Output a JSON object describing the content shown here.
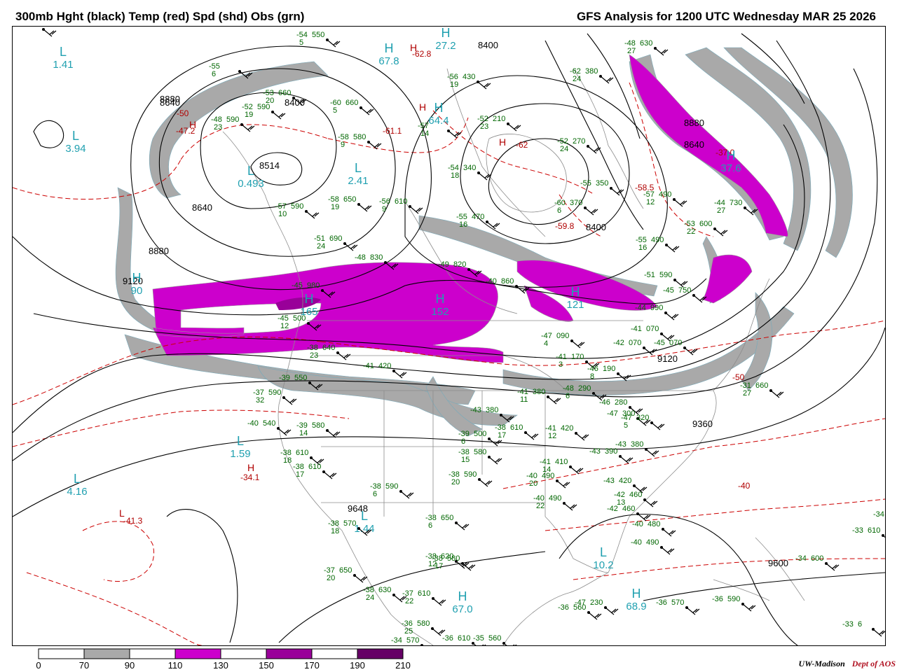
{
  "header": {
    "left_title": "300mb Hght (black) Temp (red) Spd (shd) Obs (grn)",
    "right_title": "GFS Analysis for 1200 UTC Wednesday  MAR 25 2026"
  },
  "colors": {
    "height_contour": "#000000",
    "temp_contour": "#cc0000",
    "speed_70_90": "#a9a9a9",
    "speed_110_130": "#cc00cc",
    "speed_150_170": "#990099",
    "speed_190_210": "#660066",
    "obs": "#006600",
    "pressure_centers": "#20a0b0",
    "borders": "#808080"
  },
  "legend": {
    "labels": [
      "0",
      "70",
      "90",
      "110",
      "130",
      "150",
      "170",
      "190",
      "210"
    ],
    "fills": [
      "#ffffff",
      "#a9a9a9",
      "#ffffff",
      "#cc00cc",
      "#ffffff",
      "#990099",
      "#ffffff",
      "#660066"
    ]
  },
  "credit": {
    "org": "UW-Madison",
    "dept": "Dept of AOS"
  },
  "height_labels": [
    {
      "text": "8880"
    },
    {
      "text": "8640"
    },
    {
      "text": "8514"
    },
    {
      "text": "8640"
    },
    {
      "text": "8880"
    },
    {
      "text": "9120"
    },
    {
      "text": "8400"
    },
    {
      "text": "8400"
    },
    {
      "text": "8640"
    },
    {
      "text": "8880"
    },
    {
      "text": "9120"
    },
    {
      "text": "9360"
    },
    {
      "text": "9648"
    },
    {
      "text": "9600"
    },
    {
      "text": "8400"
    }
  ],
  "temp_labels": [
    {
      "text": "-47.2"
    },
    {
      "text": "-50"
    },
    {
      "text": "-61.1"
    },
    {
      "text": "-62.8"
    },
    {
      "text": "-58.5"
    },
    {
      "text": "-59.8"
    },
    {
      "text": "-37.0"
    },
    {
      "text": "-50"
    },
    {
      "text": "-40"
    },
    {
      "text": "-34.1"
    },
    {
      "text": "-41.3"
    },
    {
      "text": "-62"
    }
  ],
  "centers": [
    {
      "letter": "L",
      "value": "1.41"
    },
    {
      "letter": "L",
      "value": "3.94"
    },
    {
      "letter": "L",
      "value": "0.493"
    },
    {
      "letter": "L",
      "value": "2.41"
    },
    {
      "letter": "H",
      "value": "67.8"
    },
    {
      "letter": "H",
      "value": "64.4"
    },
    {
      "letter": "L",
      "value": "1.59"
    },
    {
      "letter": "L",
      "value": "4.16"
    },
    {
      "letter": "L",
      "value": "1.44"
    },
    {
      "letter": "L",
      "value": "10.2"
    },
    {
      "letter": "H",
      "value": "67.0"
    },
    {
      "letter": "H",
      "value": "68.9"
    },
    {
      "letter": "H",
      "value": "27.2"
    },
    {
      "letter": "H",
      "value": "37.6"
    },
    {
      "letter": "H",
      "value": "90"
    },
    {
      "letter": "H",
      "value": "165"
    },
    {
      "letter": "H",
      "value": "152"
    },
    {
      "letter": "H",
      "value": "121"
    }
  ],
  "extrema_labels": [
    {
      "text": "H"
    },
    {
      "text": "H"
    },
    {
      "text": "H"
    },
    {
      "text": "H"
    },
    {
      "text": "L"
    },
    {
      "text": "H"
    }
  ],
  "obs": [
    {
      "t": "-54",
      "h": "550",
      "s": "5"
    },
    {
      "t": "-53",
      "h": "660",
      "s": "20"
    },
    {
      "t": "-55",
      "h": "",
      "s": "6"
    },
    {
      "t": "-52",
      "h": "590",
      "s": "19"
    },
    {
      "t": "-48",
      "h": "590",
      "s": "23"
    },
    {
      "t": "-60",
      "h": "660",
      "s": "5"
    },
    {
      "t": "-58",
      "h": "580",
      "s": "9"
    },
    {
      "t": "-57",
      "h": "",
      "s": "14"
    },
    {
      "t": "-56",
      "h": "430",
      "s": "19"
    },
    {
      "t": "-52",
      "h": "210",
      "s": "23"
    },
    {
      "t": "-52",
      "h": "270",
      "s": "24"
    },
    {
      "t": "-62",
      "h": "380",
      "s": "24"
    },
    {
      "t": "-48",
      "h": "630",
      "s": "27"
    },
    {
      "t": "-54",
      "h": "340",
      "s": "18"
    },
    {
      "t": "-55",
      "h": "350",
      "s": ""
    },
    {
      "t": "-57",
      "h": "490",
      "s": "12"
    },
    {
      "t": "-60",
      "h": "370",
      "s": "6"
    },
    {
      "t": "-58",
      "h": "650",
      "s": "19"
    },
    {
      "t": "-56",
      "h": "610",
      "s": "9"
    },
    {
      "t": "-57",
      "h": "590",
      "s": "10"
    },
    {
      "t": "-51",
      "h": "690",
      "s": "24"
    },
    {
      "t": "-55",
      "h": "470",
      "s": "16"
    },
    {
      "t": "-44",
      "h": "730",
      "s": "27"
    },
    {
      "t": "-53",
      "h": "600",
      "s": "22"
    },
    {
      "t": "-55",
      "h": "490",
      "s": "16"
    },
    {
      "t": "-51",
      "h": "590",
      "s": ""
    },
    {
      "t": "-45",
      "h": "750",
      "s": ""
    },
    {
      "t": "-48",
      "h": "830",
      "s": ""
    },
    {
      "t": "-49",
      "h": "820",
      "s": ""
    },
    {
      "t": "-40",
      "h": "860",
      "s": ""
    },
    {
      "t": "-45",
      "h": "980",
      "s": ""
    },
    {
      "t": "-44",
      "h": "990",
      "s": ""
    },
    {
      "t": "-41",
      "h": "070",
      "s": ""
    },
    {
      "t": "-42",
      "h": "070",
      "s": ""
    },
    {
      "t": "-45",
      "h": "070",
      "s": ""
    },
    {
      "t": "-47",
      "h": "090",
      "s": "4"
    },
    {
      "t": "-41",
      "h": "170",
      "s": "3"
    },
    {
      "t": "-46",
      "h": "190",
      "s": "8"
    },
    {
      "t": "-48",
      "h": "290",
      "s": "6"
    },
    {
      "t": "-41",
      "h": "380",
      "s": "11"
    },
    {
      "t": "-46",
      "h": "280",
      "s": ""
    },
    {
      "t": "-47",
      "h": "300",
      "s": ""
    },
    {
      "t": "-47",
      "h": "320",
      "s": "5"
    },
    {
      "t": "-43",
      "h": "380",
      "s": ""
    },
    {
      "t": "-41",
      "h": "420",
      "s": "12"
    },
    {
      "t": "-43",
      "h": "390",
      "s": ""
    },
    {
      "t": "-41",
      "h": "410",
      "s": "14"
    },
    {
      "t": "-43",
      "h": "420",
      "s": ""
    },
    {
      "t": "-40",
      "h": "490",
      "s": "20"
    },
    {
      "t": "-40",
      "h": "490",
      "s": "22"
    },
    {
      "t": "-42",
      "h": "460",
      "s": "13"
    },
    {
      "t": "-42",
      "h": "460",
      "s": ""
    },
    {
      "t": "-40",
      "h": "480",
      "s": ""
    },
    {
      "t": "-40",
      "h": "490",
      "s": ""
    },
    {
      "t": "-43",
      "h": "380",
      "s": ""
    },
    {
      "t": "-38",
      "h": "610",
      "s": "17"
    },
    {
      "t": "-39",
      "h": "500",
      "s": "6"
    },
    {
      "t": "-38",
      "h": "580",
      "s": "15"
    },
    {
      "t": "-38",
      "h": "590",
      "s": "20"
    },
    {
      "t": "-38",
      "h": "590",
      "s": "6"
    },
    {
      "t": "-38",
      "h": "650",
      "s": "6"
    },
    {
      "t": "-38",
      "h": "620",
      "s": "12"
    },
    {
      "t": "-38",
      "h": "580",
      "s": "17"
    },
    {
      "t": "-38",
      "h": "570",
      "s": "18"
    },
    {
      "t": "-37",
      "h": "650",
      "s": "20"
    },
    {
      "t": "-38",
      "h": "630",
      "s": "24"
    },
    {
      "t": "-37",
      "h": "610",
      "s": "22"
    },
    {
      "t": "-36",
      "h": "580",
      "s": "25"
    },
    {
      "t": "-37",
      "h": "590",
      "s": "32"
    },
    {
      "t": "-39",
      "h": "550",
      "s": ""
    },
    {
      "t": "-40",
      "h": "540",
      "s": ""
    },
    {
      "t": "-39",
      "h": "580",
      "s": "14"
    },
    {
      "t": "-38",
      "h": "610",
      "s": "18"
    },
    {
      "t": "-38",
      "h": "610",
      "s": "17"
    },
    {
      "t": "-38",
      "h": "640",
      "s": "23"
    },
    {
      "t": "-41",
      "h": "420",
      "s": ""
    },
    {
      "t": "-45",
      "h": "500",
      "s": "12"
    },
    {
      "t": "-47",
      "h": "230",
      "s": ""
    },
    {
      "t": "-36",
      "h": "560",
      "s": ""
    },
    {
      "t": "-36",
      "h": "570",
      "s": ""
    },
    {
      "t": "-36",
      "h": "590",
      "s": ""
    },
    {
      "t": "-36",
      "h": "610",
      "s": ""
    },
    {
      "t": "-35",
      "h": "560",
      "s": ""
    },
    {
      "t": "-34",
      "h": "570",
      "s": ""
    },
    {
      "t": "-34",
      "h": "600",
      "s": ""
    },
    {
      "t": "-33",
      "h": "610",
      "s": ""
    },
    {
      "t": "-34",
      "h": "620",
      "s": ""
    },
    {
      "t": "-33",
      "h": "6",
      "s": ""
    },
    {
      "t": "-31",
      "h": "660",
      "s": "27"
    },
    {
      "t": "-43",
      "h": "380",
      "s": ""
    }
  ]
}
